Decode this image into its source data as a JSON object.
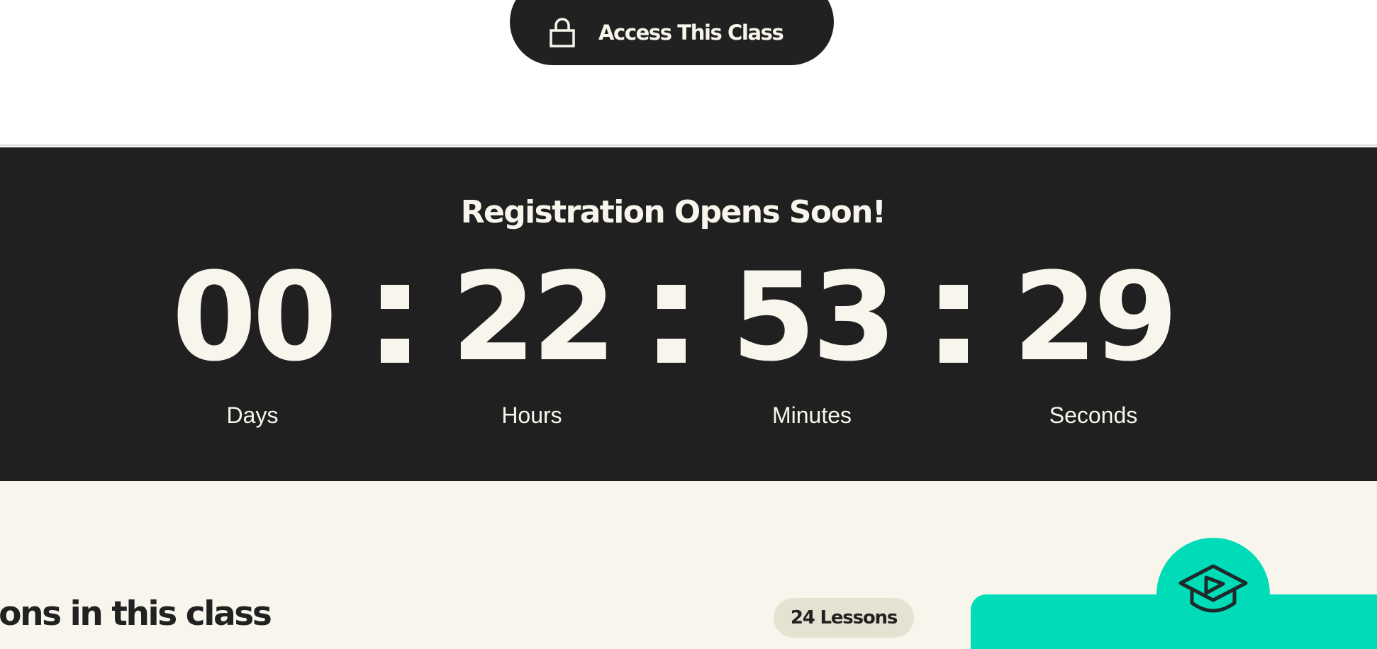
{
  "access_button": {
    "label": "Access This Class",
    "icon": "lock-icon"
  },
  "countdown": {
    "title": "Registration Opens Soon!",
    "units": [
      {
        "value": "00",
        "label": "Days"
      },
      {
        "value": "22",
        "label": "Hours"
      },
      {
        "value": "53",
        "label": "Minutes"
      },
      {
        "value": "29",
        "label": "Seconds"
      }
    ],
    "separator": ":"
  },
  "lessons_section": {
    "heading": "Lessons in this class",
    "badge": "24 Lessons",
    "card_icon": "graduation-cap-play-icon"
  },
  "colors": {
    "dark": "#202020",
    "cream": "#f8f6ec",
    "accent": "#00dbb8",
    "badge": "#e6e2d2"
  }
}
